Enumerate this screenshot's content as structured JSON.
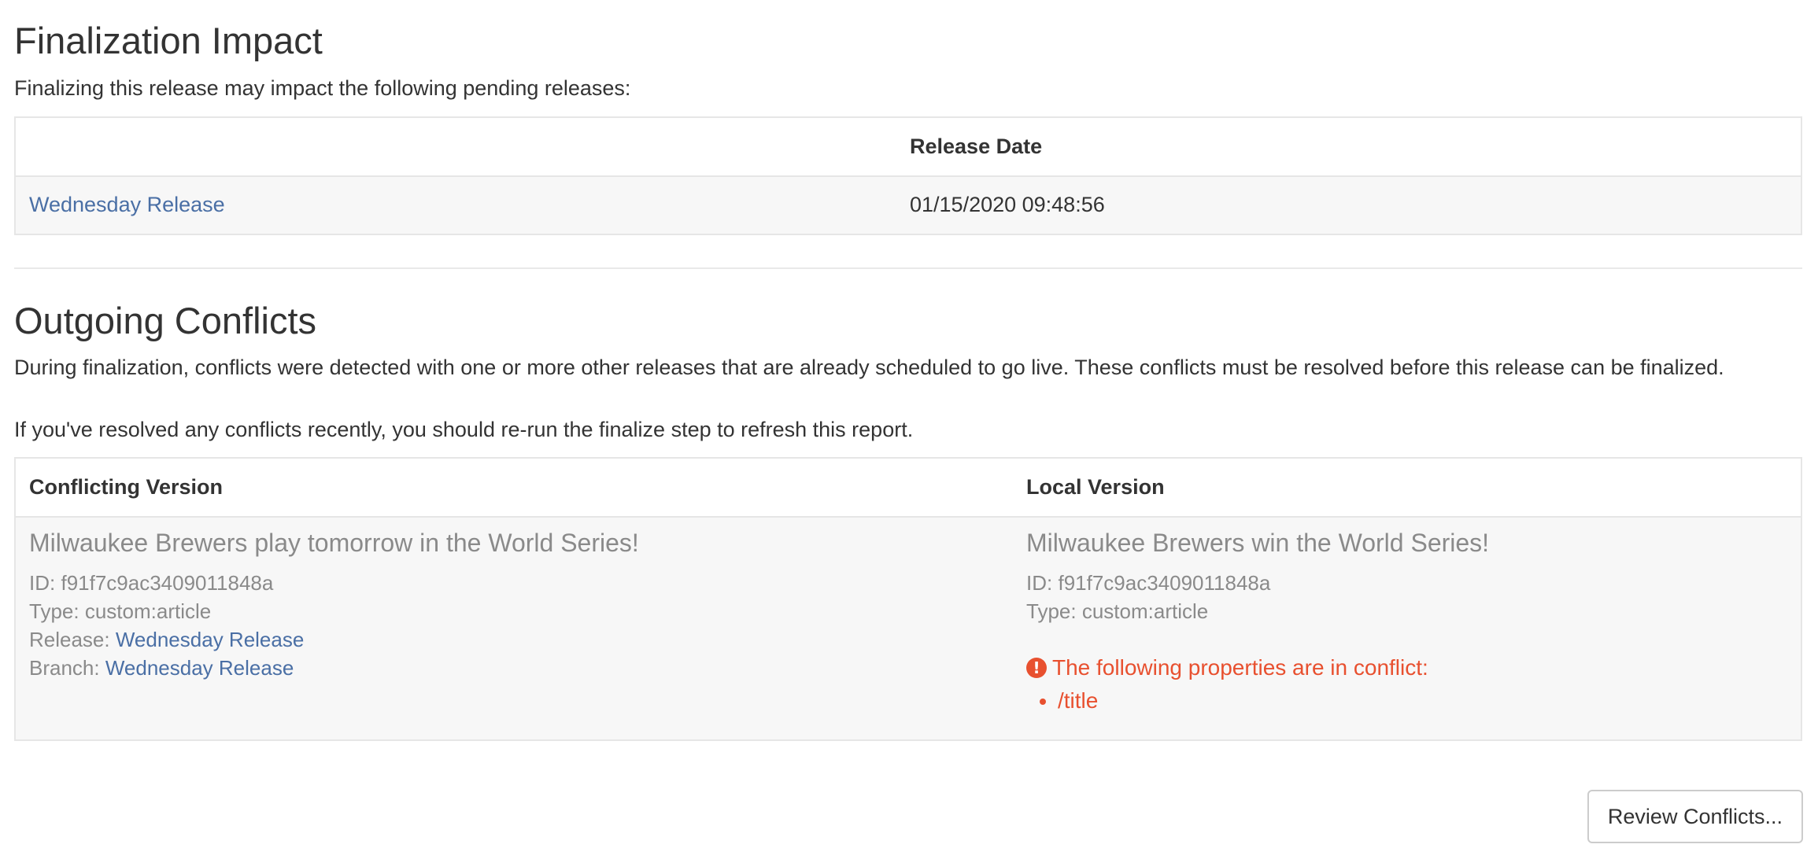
{
  "impact": {
    "heading": "Finalization Impact",
    "description": "Finalizing this release may impact the following pending releases:",
    "table": {
      "headers": [
        "",
        "Release Date"
      ],
      "rows": [
        {
          "name": "Wednesday Release",
          "date": "01/15/2020 09:48:56"
        }
      ]
    }
  },
  "conflicts": {
    "heading": "Outgoing Conflicts",
    "description_1": "During finalization, conflicts were detected with one or more other releases that are already scheduled to go live. These conflicts must be resolved before this release can be finalized.",
    "description_2": "If you've resolved any conflicts recently, you should re-run the finalize step to refresh this report.",
    "table": {
      "headers": [
        "Conflicting Version",
        "Local Version"
      ],
      "conflicting": {
        "title": "Milwaukee Brewers play tomorrow in the World Series!",
        "id_label": "ID:",
        "id_value": "f91f7c9ac3409011848a",
        "type_label": "Type:",
        "type_value": "custom:article",
        "release_label": "Release:",
        "release_value": "Wednesday Release",
        "branch_label": "Branch:",
        "branch_value": "Wednesday Release"
      },
      "local": {
        "title": "Milwaukee Brewers win the World Series!",
        "id_label": "ID:",
        "id_value": "f91f7c9ac3409011848a",
        "type_label": "Type:",
        "type_value": "custom:article",
        "warning_icon": "exclamation-circle-icon",
        "warning_glyph": "!",
        "warning_text": "The following properties are in conflict:",
        "properties": [
          "/title"
        ]
      }
    }
  },
  "actions": {
    "review_label": "Review Conflicts..."
  },
  "colors": {
    "link": "#4a6fa5",
    "warning": "#e8502f",
    "muted": "#8a8a8a"
  }
}
